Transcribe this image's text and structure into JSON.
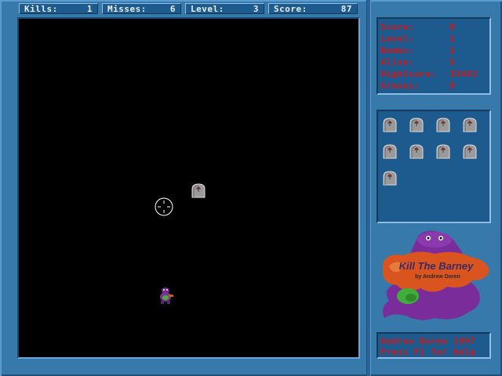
{
  "topbar": {
    "kills_label": "Kills:",
    "kills_value": "1",
    "misses_label": "Misses:",
    "misses_value": "6",
    "level_label": "Level:",
    "level_value": "3",
    "score_label": "Score:",
    "score_value": "87"
  },
  "info": {
    "rows": [
      {
        "label": "Score:",
        "value": "0"
      },
      {
        "label": "Level:",
        "value": "1"
      },
      {
        "label": "Bombs:",
        "value": "1"
      },
      {
        "label": "Alive:",
        "value": "5"
      },
      {
        "label": "HighScore:",
        "value": "33483"
      },
      {
        "label": "Graves:",
        "value": "9"
      }
    ]
  },
  "graves_count": 9,
  "logo": {
    "title": "Kill The Barney",
    "byline": "by Andrew Doren"
  },
  "credits": {
    "line1": "Andrew Doren 1997",
    "line2": "Press F1 for Help"
  },
  "colors": {
    "panel_text": "#d4161a",
    "frame": "#3779ab",
    "playfield": "#000000"
  },
  "icons": {
    "grave": "tombstone-icon",
    "crosshair": "crosshair-icon",
    "barney": "barney-sprite"
  }
}
